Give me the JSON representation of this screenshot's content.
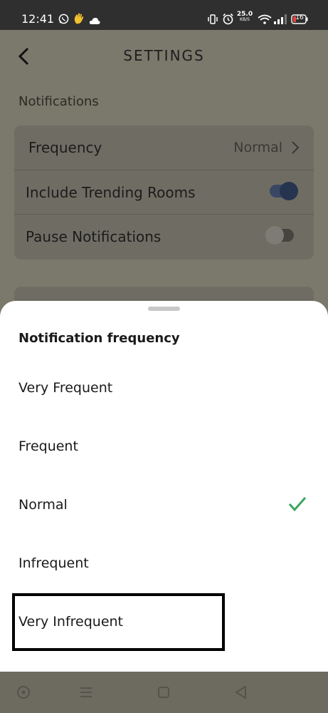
{
  "status_bar": {
    "time": "12:41",
    "left_icons": [
      "whatsapp-icon",
      "hand-wave-icon",
      "cloud-icon"
    ],
    "right_icons": [
      "vibrate-icon",
      "alarm-icon",
      "wifi-icon",
      "signal-icon",
      "battery-icon"
    ],
    "data_speed": "25.0",
    "data_speed_unit": "KB/S",
    "battery_level": "16"
  },
  "header": {
    "title": "SETTINGS",
    "back_icon": "chevron-left-icon"
  },
  "notifications": {
    "section_label": "Notifications",
    "rows": [
      {
        "label": "Frequency",
        "value": "Normal",
        "control": "chevron"
      },
      {
        "label": "Include Trending Rooms",
        "control": "toggle",
        "on": true
      },
      {
        "label": "Pause Notifications",
        "control": "toggle",
        "on": false
      }
    ]
  },
  "sheet": {
    "title": "Notification frequency",
    "options": [
      {
        "label": "Very Frequent",
        "selected": false
      },
      {
        "label": "Frequent",
        "selected": false
      },
      {
        "label": "Normal",
        "selected": true
      },
      {
        "label": "Infrequent",
        "selected": false
      },
      {
        "label": "Very Infrequent",
        "selected": false
      }
    ],
    "check_color": "#3aa55d"
  },
  "nav_bar": {
    "buttons": [
      "assistant-icon",
      "menu-icon",
      "home-icon",
      "back-triangle-icon"
    ]
  },
  "colors": {
    "status_bar_bg": "#2f2f2f",
    "scrim": "#7b786c",
    "sheet_bg": "#ffffff",
    "toggle_on": "#263450"
  }
}
